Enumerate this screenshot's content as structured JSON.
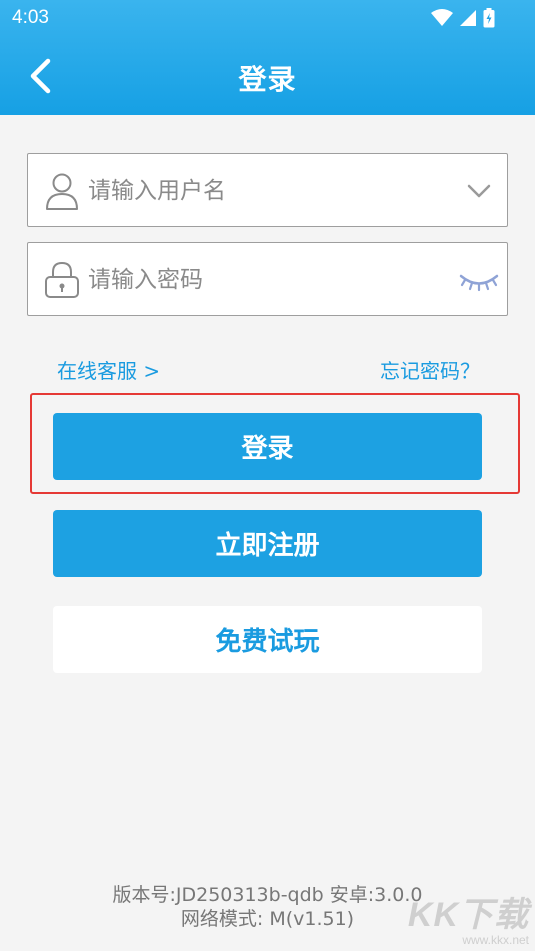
{
  "status_bar": {
    "time": "4:03"
  },
  "header": {
    "title": "登录"
  },
  "form": {
    "username_placeholder": "请输入用户名",
    "password_placeholder": "请输入密码"
  },
  "links": {
    "online_service": "在线客服 >",
    "forgot_password": "忘记密码？"
  },
  "buttons": {
    "login": "登录",
    "register": "立即注册",
    "free_trial": "免费试玩"
  },
  "footer": {
    "version_line": "版本号:JD250313b-qdb  安卓:3.0.0",
    "network_line": "网络模式: M(v1.51)"
  },
  "watermark": {
    "logo": "KK下载",
    "url": "www.kkx.net"
  },
  "colors": {
    "accent": "#1da1e2",
    "highlight_border": "#e53935",
    "link": "#1a9be0"
  },
  "icons": {
    "back": "chevron-left-icon",
    "user": "user-icon",
    "lock": "lock-icon",
    "dropdown": "chevron-down-icon",
    "password_toggle": "eye-closed-icon",
    "wifi": "wifi-icon",
    "signal": "signal-icon",
    "battery": "battery-icon"
  }
}
